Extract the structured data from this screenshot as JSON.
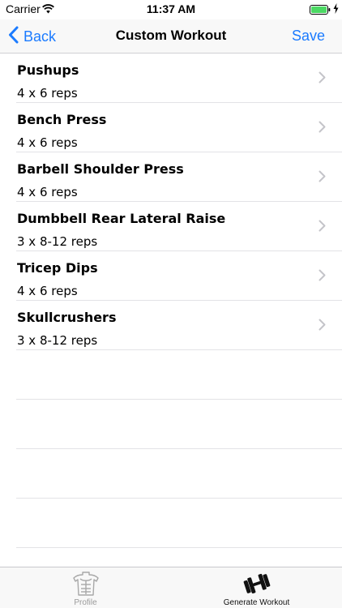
{
  "status_bar": {
    "carrier": "Carrier",
    "time": "11:37 AM"
  },
  "nav": {
    "back_label": "Back",
    "title": "Custom Workout",
    "save_label": "Save"
  },
  "exercises": [
    {
      "name": "Pushups",
      "detail": "4 x 6 reps"
    },
    {
      "name": "Bench Press",
      "detail": "4 x 6 reps"
    },
    {
      "name": "Barbell Shoulder Press",
      "detail": "4 x 6 reps"
    },
    {
      "name": "Dumbbell Rear Lateral Raise",
      "detail": "3 x 8-12 reps"
    },
    {
      "name": "Tricep Dips",
      "detail": "4 x 6 reps"
    },
    {
      "name": "Skullcrushers",
      "detail": "3 x 8-12 reps"
    }
  ],
  "tabs": [
    {
      "label": "Profile",
      "icon": "torso-icon",
      "selected": false
    },
    {
      "label": "Generate Workout",
      "icon": "dumbbell-icon",
      "selected": true
    }
  ],
  "colors": {
    "accent": "#1b7bff",
    "battery": "#4cd964"
  }
}
